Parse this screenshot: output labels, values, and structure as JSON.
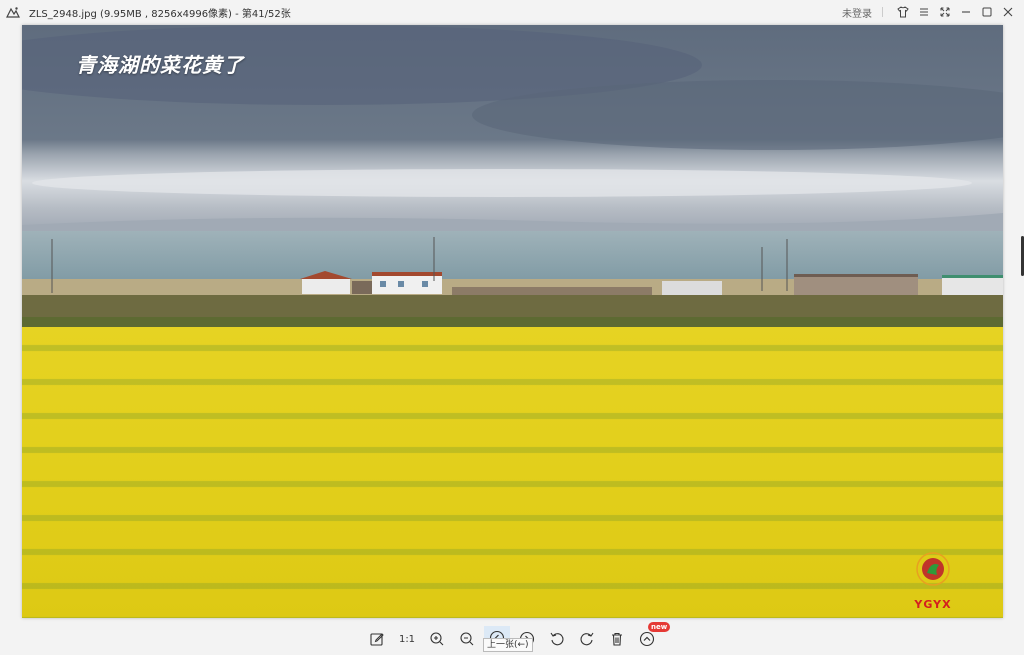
{
  "window": {
    "title": "ZLS_2948.jpg (9.95MB , 8256x4996像素) - 第41/52张",
    "login_label": "未登录",
    "controls": [
      "shirt-icon",
      "menu-icon",
      "fullscreen-icon",
      "minimize-icon",
      "maximize-icon",
      "close-icon"
    ]
  },
  "photo": {
    "caption": "青海湖的菜花黄了",
    "watermark_text": "YGYX",
    "colors": {
      "sky": "#5d6a7c",
      "lake": "#8aa6b0",
      "field": "#e8d31a"
    }
  },
  "toolbar": {
    "tools": [
      {
        "name": "edit-icon"
      },
      {
        "name": "actual-size",
        "label": "1:1"
      },
      {
        "name": "zoom-in-icon"
      },
      {
        "name": "zoom-out-icon"
      },
      {
        "name": "previous-icon"
      },
      {
        "name": "next-icon"
      },
      {
        "name": "rotate-left-icon"
      },
      {
        "name": "rotate-right-icon"
      },
      {
        "name": "delete-icon"
      },
      {
        "name": "more-icon",
        "badge": "new"
      }
    ],
    "tooltip": "上一张(←)",
    "active_tool": "previous-icon"
  }
}
